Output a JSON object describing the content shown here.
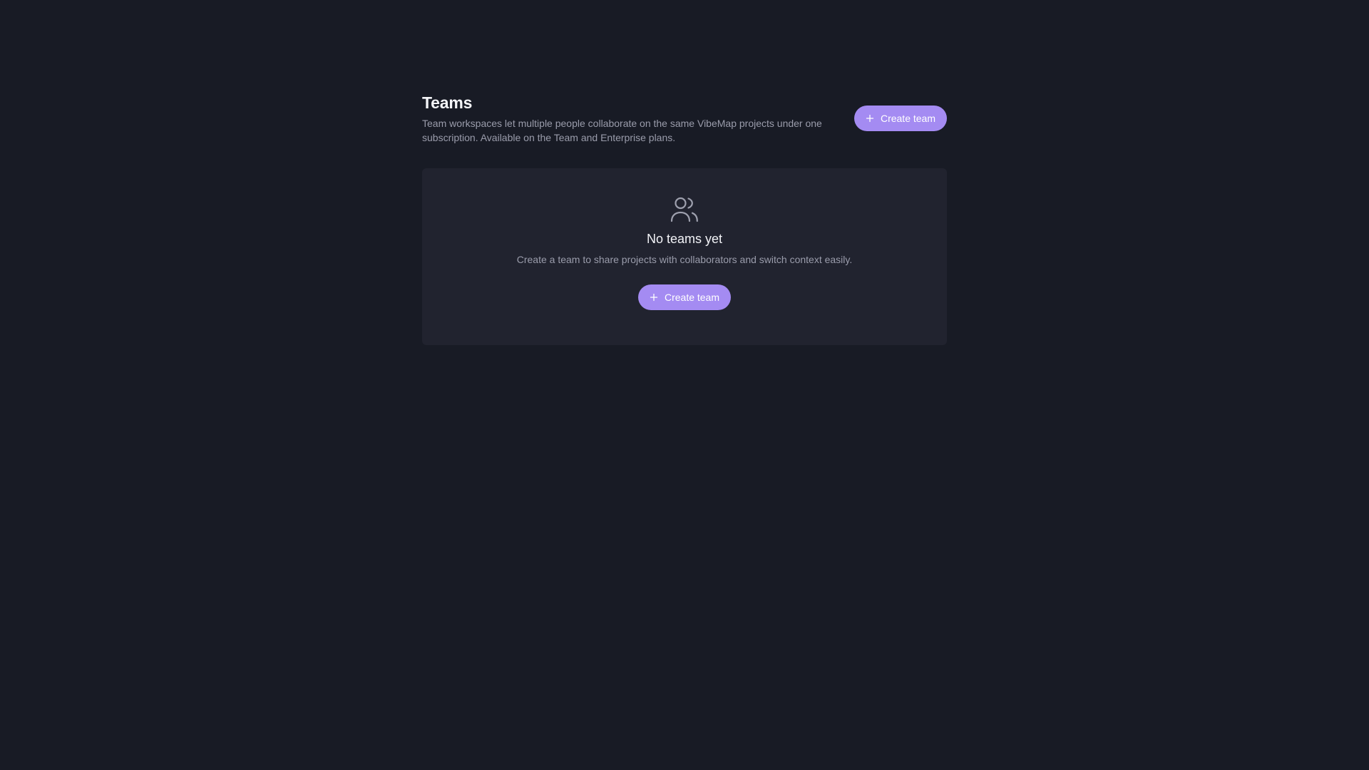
{
  "header": {
    "title": "Teams",
    "description": "Team workspaces let multiple people collaborate on the same VibeMap projects under one subscription. Available on the Team and Enterprise plans.",
    "create_button_label": "Create team",
    "create_button_icon": "plus-icon"
  },
  "empty_state": {
    "icon": "users-icon",
    "title": "No teams yet",
    "description": "Create a team to share projects with collaborators and switch context easily.",
    "create_button_label": "Create team",
    "create_button_icon": "plus-icon"
  },
  "colors": {
    "background": "#181b25",
    "card": "#21232f",
    "accent": "#a48bf2",
    "muted_text": "#9a9cab"
  }
}
